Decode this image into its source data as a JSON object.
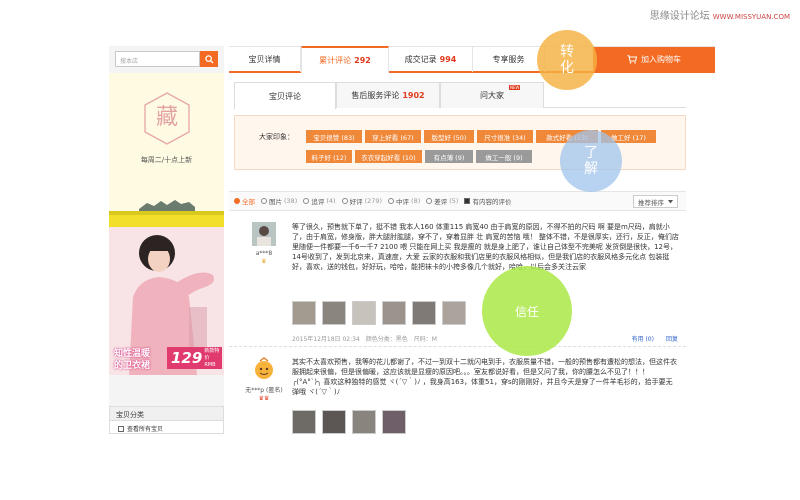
{
  "watermark": {
    "text": "思缘设计论坛",
    "url": "WWW.MISSYUAN.COM"
  },
  "sidebar": {
    "search_placeholder": "搜本店",
    "brand_char": "藏",
    "slogan": "每周二/十点上新",
    "promo": {
      "line1": "知性温暖",
      "line2": "的卫衣裙",
      "price": "129",
      "price_tag1": "新款特价",
      "price_tag2": "RMB"
    },
    "category_title": "宝贝分类",
    "category_item": "查看所有宝贝"
  },
  "tabs": [
    {
      "label": "宝贝详情",
      "count": ""
    },
    {
      "label": "累计评论",
      "count": "292"
    },
    {
      "label": "成交记录",
      "count": "994"
    },
    {
      "label": "专享服务",
      "count": ""
    }
  ],
  "cart_label": "加入购物车",
  "subtabs": [
    {
      "label": "宝贝评论",
      "count": ""
    },
    {
      "label": "售后服务评论",
      "count": "1902"
    },
    {
      "label": "问大家",
      "count": ""
    }
  ],
  "hot_badge": "NEW",
  "tags_label": "大家印象：",
  "tags": [
    {
      "text": "宝贝很赞 (83)",
      "neg": false
    },
    {
      "text": "穿上好看 (67)",
      "neg": false
    },
    {
      "text": "版型好 (50)",
      "neg": false
    },
    {
      "text": "尺寸很准 (34)",
      "neg": false
    },
    {
      "text": "款式好看 (23)",
      "neg": false
    },
    {
      "text": "做工好 (17)",
      "neg": false
    },
    {
      "text": "料子好 (12)",
      "neg": false
    },
    {
      "text": "衣衣穿起好看 (10)",
      "neg": false
    },
    {
      "text": "有点薄 (9)",
      "neg": true
    },
    {
      "text": "做工一般 (9)",
      "neg": true
    }
  ],
  "filters": [
    {
      "label": "全部",
      "count": "",
      "on": true
    },
    {
      "label": "图片",
      "count": "(38)",
      "on": false
    },
    {
      "label": "追评",
      "count": "(4)",
      "on": false
    },
    {
      "label": "好评",
      "count": "(279)",
      "on": false
    },
    {
      "label": "中评",
      "count": "(8)",
      "on": false
    },
    {
      "label": "差评",
      "count": "(5)",
      "on": false
    }
  ],
  "content_filter": "有内容的评价",
  "sort_label": "推荐排序",
  "reviews": [
    {
      "user": "a***8",
      "badge": "♛",
      "text": "等了很久，预售就下单了，挺不错 我本人160 体重115 肩宽40 由于肩宽的原因，不得不拍的尺码 啊 要是m尺码，肩就小了，由于肩宽，修身版，胖大腿肘肱腿，穿不了，穿着显胖 壮 肩宽的苦恼 哦！ 整体不错，不是很厚实，还行，反正，俺们店里随便一件都要一千6一千7 2100 喂 只能在网上买 我是瘦的 就是身上肥了，谁让自己体型不完美呢 发货倒是很快，12号，14号收到了，发到北京来，真速度，大爱 云家的衣服和我们店里的衣服风格相似，但是我们店的衣服风格多元化点 包装挺好，喜欢，送的钱包，好好玩，哈哈，能把袜卡的小挎多像几个就好，哈哈，以后会多关注云家",
      "date": "2015年12月18日 02:34",
      "color": "颜色分类：黑色",
      "size": "尺码：M",
      "useful": "有用 (0)",
      "reply": "回复"
    },
    {
      "user": "无***p (匿名)",
      "badge": "♛♛",
      "text": "其实不太喜欢预售，我等的花儿都谢了，不过一到双十二就闪电到手，衣服质量不错，一般的预售都有遭松的想法，但这件衣服拥起来很偏，但是很偏暖，这应该就是显瘦的原因吧。。。室友都说好看，但是又问了我，你的腰怎么不见了！！！ ╭(°A°`)╮ 喜欢这种独特的感觉 ヾ(´▽｀)ﾉ ，我身高163，体重51，穿s的刚刚好，并且今天是穿了一件羊毛衫的，拾手要无弹哦 ヾ(´▽｀)ﾉ"
    }
  ],
  "overlays": {
    "conversion": "转化",
    "understand": "了解",
    "trust": "信任"
  }
}
